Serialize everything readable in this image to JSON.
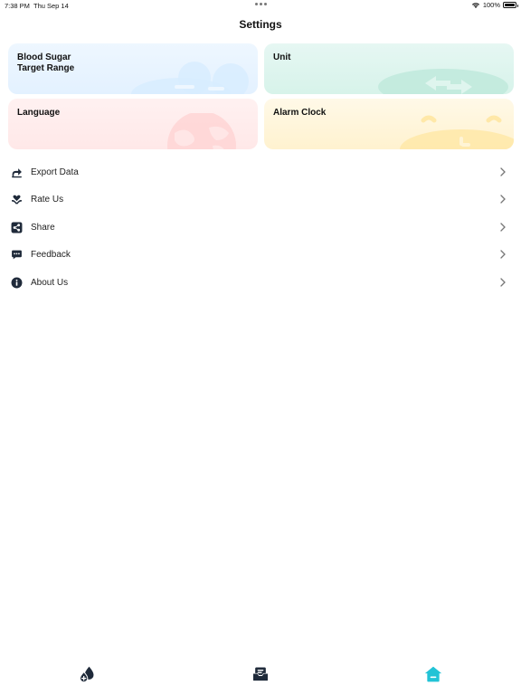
{
  "status_bar": {
    "time": "7:38 PM",
    "date": "Thu Sep 14",
    "battery": "100%"
  },
  "header": {
    "title": "Settings"
  },
  "cards": {
    "blood_sugar": {
      "label": "Blood Sugar\nTarget Range",
      "icon": "cloud-icon",
      "color": "#d7ecff"
    },
    "unit": {
      "label": "Unit",
      "icon": "swap-icon",
      "color": "#bfe9dc"
    },
    "language": {
      "label": "Language",
      "icon": "globe-icon",
      "color": "#ffd3d3"
    },
    "alarm_clock": {
      "label": "Alarm Clock",
      "icon": "clock-icon",
      "color": "#ffe8a8"
    }
  },
  "menu": {
    "items": [
      {
        "label": "Export Data",
        "icon": "export-icon"
      },
      {
        "label": "Rate Us",
        "icon": "heart-hand-icon"
      },
      {
        "label": "Share",
        "icon": "share-icon"
      },
      {
        "label": "Feedback",
        "icon": "feedback-icon"
      },
      {
        "label": "About Us",
        "icon": "info-icon"
      }
    ]
  },
  "tab_bar": {
    "tabs": [
      {
        "name": "records",
        "icon": "blood-drop-icon",
        "color": "#1f2a3a",
        "active": false
      },
      {
        "name": "inbox",
        "icon": "inbox-icon",
        "color": "#1f2a3a",
        "active": false
      },
      {
        "name": "home",
        "icon": "home-icon",
        "color": "#22c3d6",
        "active": true
      }
    ]
  }
}
